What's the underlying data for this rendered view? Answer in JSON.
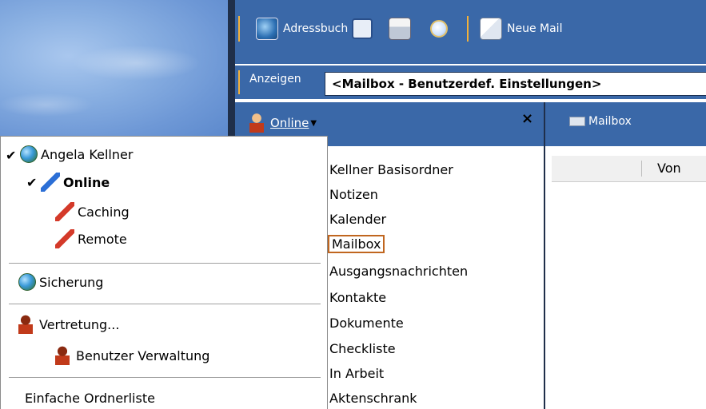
{
  "toolbar": {
    "adressbuch_label": "Adressbuch",
    "neue_mail_label": "Neue Mail"
  },
  "view": {
    "anzeigen_label": "Anzeigen",
    "selected_view": "<Mailbox - Benutzerdef. Einstellungen>"
  },
  "panel": {
    "online_tab": "Online",
    "close_symbol": "×",
    "mailbox_tab": "Mailbox"
  },
  "folders": [
    {
      "label": "Kellner Basisordner"
    },
    {
      "label": "Notizen"
    },
    {
      "label": "Kalender"
    },
    {
      "label": "Mailbox",
      "selected": true
    },
    {
      "label": "Ausgangsnachrichten"
    },
    {
      "label": "Kontakte"
    },
    {
      "label": "Dokumente"
    },
    {
      "label": "Checkliste"
    },
    {
      "label": "In Arbeit"
    },
    {
      "label": "Aktenschrank"
    }
  ],
  "mail_list": {
    "col_von": "Von"
  },
  "menu": {
    "user_name": "Angela Kellner",
    "online": "Online",
    "caching": "Caching",
    "remote": "Remote",
    "sicherung": "Sicherung",
    "vertretung": "Vertretung...",
    "benutzer_verwaltung": "Benutzer Verwaltung",
    "einfache_ordnerliste": "Einfache Ordnerliste",
    "checkmark": "✔"
  },
  "colors": {
    "toolbar_blue": "#3a68a8",
    "divider": "#1f2f4a",
    "accent_orange": "#f3b13a",
    "selection_border": "#c0661f"
  }
}
